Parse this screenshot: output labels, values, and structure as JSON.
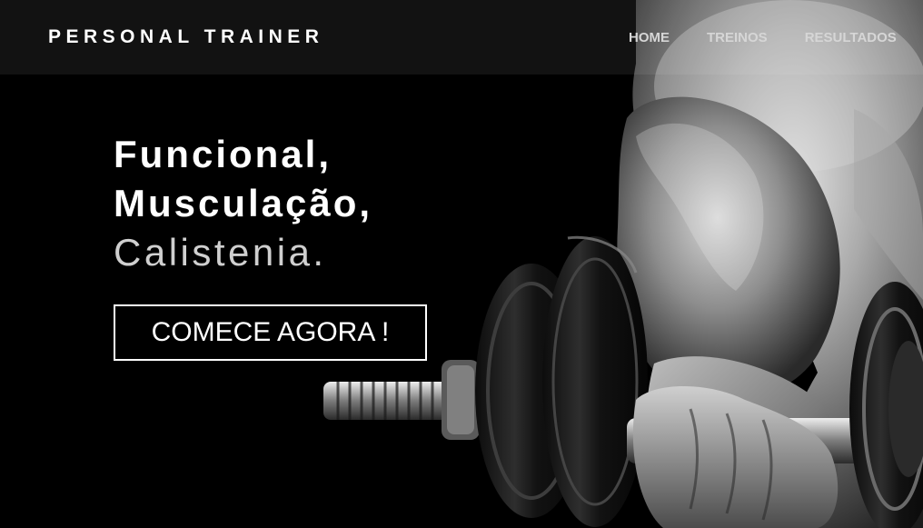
{
  "header": {
    "brand": "PERSONAL TRAINER",
    "nav": [
      {
        "label": "HOME"
      },
      {
        "label": "TREINOS"
      },
      {
        "label": "RESULTADOS"
      }
    ]
  },
  "hero": {
    "headline": {
      "line1": "Funcional,",
      "line2": "Musculação,",
      "line3": "Calistenia."
    },
    "cta_label": "COMECE AGORA !",
    "image": "grayscale-athlete-holding-dumbbell"
  },
  "colors": {
    "background": "#000000",
    "header_overlay": "#1a1a1a",
    "text_primary": "#ffffff",
    "text_secondary": "#cfcfcf",
    "nav_text": "#d6d6d6"
  }
}
